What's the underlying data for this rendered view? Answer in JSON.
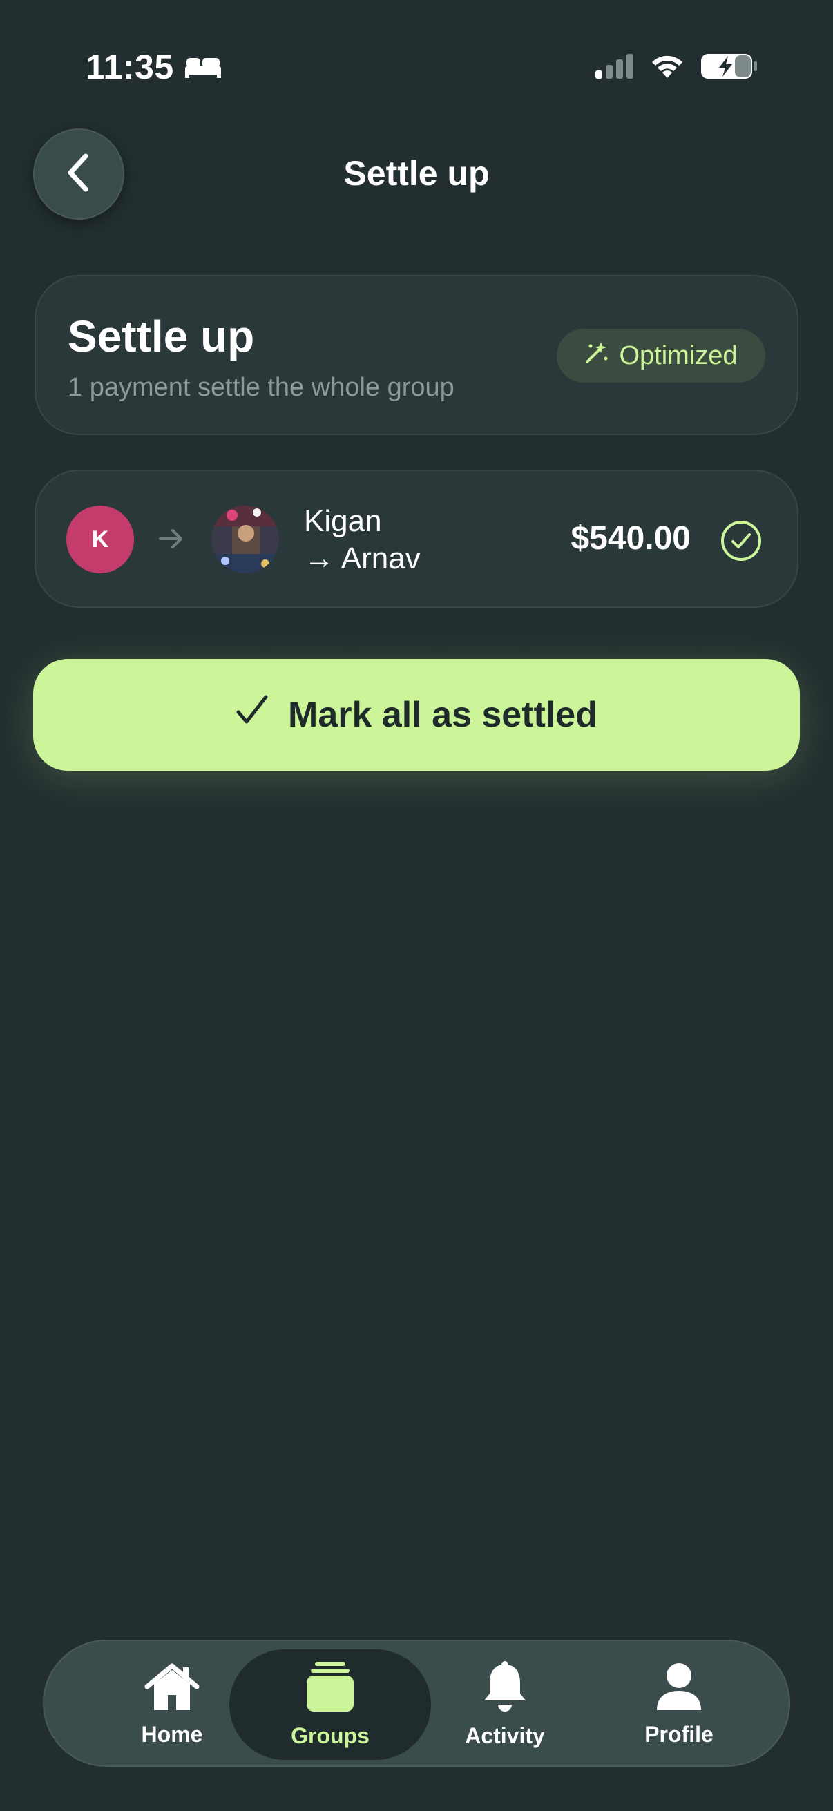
{
  "status_bar": {
    "time": "11:35",
    "icons": [
      "bed-icon",
      "signal-icon",
      "wifi-icon",
      "battery-charging-icon"
    ]
  },
  "header": {
    "title": "Settle up",
    "back_icon": "chevron-left-icon"
  },
  "summary": {
    "title": "Settle up",
    "subtitle": "1 payment settle the whole group",
    "badge_label": "Optimized",
    "badge_icon": "magic-wand-icon"
  },
  "payment": {
    "from_initial": "K",
    "from_name": "Kigan",
    "to_name": "→ Arnav",
    "amount": "$540.00",
    "status_icon": "check-circle-icon"
  },
  "action": {
    "label": "Mark all as settled",
    "icon": "checkmark-icon"
  },
  "tabs": [
    {
      "label": "Home",
      "icon": "home-icon",
      "active": false
    },
    {
      "label": "Groups",
      "icon": "groups-icon",
      "active": true
    },
    {
      "label": "Activity",
      "icon": "bell-icon",
      "active": false
    },
    {
      "label": "Profile",
      "icon": "profile-icon",
      "active": false
    }
  ],
  "colors": {
    "background": "#222e2f",
    "card": "#2a3839",
    "accent": "#ccf59a",
    "avatar_k": "#c43c6c"
  }
}
